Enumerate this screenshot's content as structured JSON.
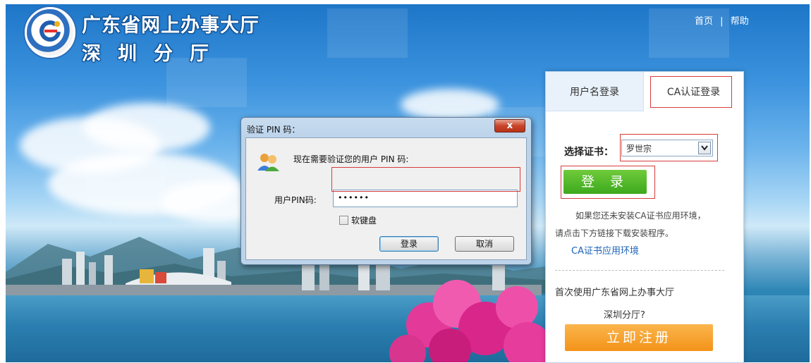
{
  "header": {
    "title_line1": "广东省网上办事大厅",
    "title_line2": "深圳分厅",
    "links": {
      "home": "首页",
      "separator": "|",
      "help": "帮助"
    }
  },
  "login_panel": {
    "tabs": [
      {
        "label": "用户名登录",
        "active": false
      },
      {
        "label": "CA认证登录",
        "active": true
      }
    ],
    "cert_label": "选择证书：",
    "cert_value": "罗世宗",
    "login_button": "登 录",
    "hint_line1": "如果您还未安装CA证书应用环境，",
    "hint_line2": "请点击下方链接下载安装程序。",
    "ca_link": "CA证书应用环境",
    "first_time_line1": "首次使用广东省网上办事大厅",
    "first_time_line2": "深圳分厅?",
    "register_button": "立即注册"
  },
  "pin_dialog": {
    "title": "验证 PIN 码：",
    "close_label": "x",
    "message": "现在需要验证您的用户 PIN 码:",
    "pin_label": "用户PIN码:",
    "pin_value": "••••••",
    "virtual_keyboard_label": "软键盘",
    "virtual_keyboard_checked": false,
    "ok_button": "登录",
    "cancel_button": "取消"
  },
  "colors": {
    "accent_green": "#4cb326",
    "accent_orange": "#f5a02a",
    "highlight_red": "#d63c3c",
    "link_blue": "#1c63b7"
  },
  "icons": {
    "logo": "portal-logo-icon",
    "dialog": "users-icon",
    "dropdown": "chevron-down-icon"
  }
}
